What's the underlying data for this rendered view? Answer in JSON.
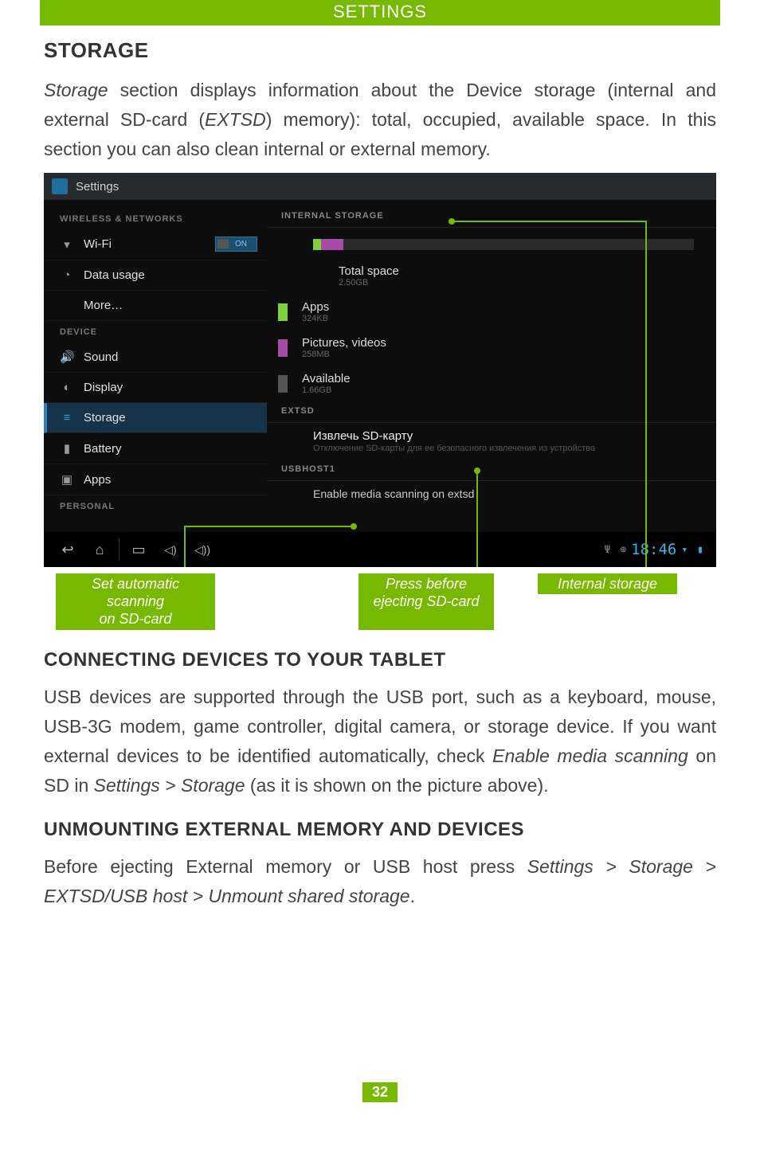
{
  "header": {
    "title": "SETTINGS"
  },
  "section1": {
    "heading": "STORAGE",
    "paragraph_parts": {
      "p1": "Storage",
      "p2": " section displays information about the Device storage (internal and external SD-card (",
      "p3": "EXTSD",
      "p4": ") memory): total, occupied, available space. In this section you can also clean internal or external memory."
    }
  },
  "screenshot": {
    "window_title": "Settings",
    "sidebar": {
      "cat_wireless": "WIRELESS & NETWORKS",
      "items_wireless": [
        {
          "icon": "▾",
          "label": "Wi-Fi",
          "toggle": "ON"
        },
        {
          "icon": "◔",
          "label": "Data usage"
        },
        {
          "icon": "",
          "label": "More…"
        }
      ],
      "cat_device": "DEVICE",
      "items_device": [
        {
          "icon": "🔊",
          "label": "Sound"
        },
        {
          "icon": "◐",
          "label": "Display"
        },
        {
          "icon": "≡",
          "label": "Storage",
          "active": true
        },
        {
          "icon": "▮",
          "label": "Battery"
        },
        {
          "icon": "▣",
          "label": "Apps"
        }
      ],
      "cat_personal": "PERSONAL"
    },
    "main": {
      "internal_header": "INTERNAL STORAGE",
      "usage_segments": [
        {
          "color": "#7fd13b",
          "start": 0,
          "width": 2
        },
        {
          "color": "#a64ca6",
          "start": 2,
          "width": 6
        }
      ],
      "stats": [
        {
          "color": null,
          "label": "Total space",
          "sub": "2.50GB"
        },
        {
          "color": "#7fd13b",
          "label": "Apps",
          "sub": "324KB"
        },
        {
          "color": "#a64ca6",
          "label": "Pictures, videos",
          "sub": "258MB"
        },
        {
          "color": "#555555",
          "label": "Available",
          "sub": "1.66GB"
        }
      ],
      "extsd_header": "EXTSD",
      "eject": {
        "label": "Извлечь SD-карту",
        "sub": "Отключение SD-карты для ее безопасного извлечения из устройства"
      },
      "usbhost_header": "USBHOST1",
      "enable_scan": "Enable media scanning on extsd"
    },
    "navbar": {
      "clock": "18:46"
    }
  },
  "annotations": {
    "a1_line1": "Set automatic scanning",
    "a1_line2": "on SD-card",
    "a2_line1": "Press before",
    "a2_line2": "ejecting SD-card",
    "a3": "Internal storage"
  },
  "section2": {
    "heading": "CONNECTING DEVICES TO YOUR TABLET",
    "para": {
      "p1": "USB devices are supported through the USB port, such as a keyboard, mouse, USB-3G modem, game controller, digital camera, or storage device. If you want external devices to be identified automatically, check ",
      "p2": "Enable media scanning",
      "p3": " on SD in ",
      "p4": "Settings > Storage",
      "p5": " (as it is shown on the picture above)."
    }
  },
  "section3": {
    "heading": "UNMOUNTING EXTERNAL MEMORY AND DEVICES",
    "para": {
      "p1": "Before ejecting External memory or USB host press ",
      "p2": "Settings > Storage > EXTSD/USB host > Unmount shared storage",
      "p3": "."
    }
  },
  "page_number": "32"
}
